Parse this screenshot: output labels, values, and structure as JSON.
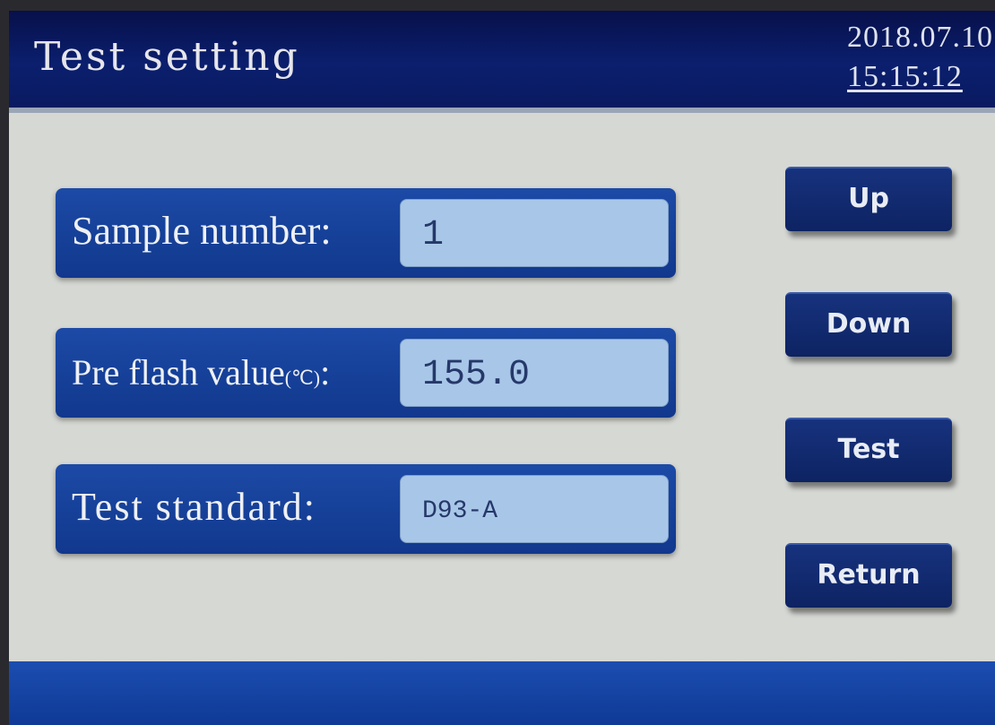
{
  "header": {
    "title": "Test setting",
    "date": "2018.07.10",
    "time": "15:15:12"
  },
  "fields": [
    {
      "label": "Sample number:",
      "unit": "",
      "suffix": "",
      "value": "1"
    },
    {
      "label": "Pre flash value",
      "unit": "(℃)",
      "suffix": ":",
      "value": "155.0"
    },
    {
      "label": "Test standard:",
      "unit": "",
      "suffix": "",
      "value": "D93-A"
    }
  ],
  "buttons": {
    "up": "Up",
    "down": "Down",
    "test": "Test",
    "return": "Return"
  },
  "colors": {
    "header_bg": "#0b1f6e",
    "panel_bg": "#11388d",
    "value_bg": "#a8c7e8",
    "screen_bg": "#d6d8d4"
  }
}
